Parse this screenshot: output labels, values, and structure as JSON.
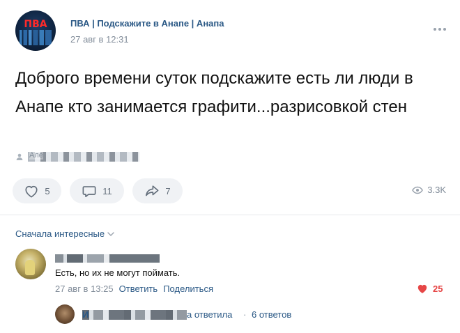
{
  "post": {
    "group_name": "ПВА | Подскажите в Анапе | Анапа",
    "avatar_logo": "ПВА",
    "time": "27 авг в 12:31",
    "text": "Доброго времени суток подскажите есть ли люди в Анапе кто занимается графити...разрисовкой стен",
    "author_prefix": "Але"
  },
  "actions": {
    "likes": "5",
    "comments": "11",
    "shares": "7",
    "views": "3.3K"
  },
  "comments": {
    "sort_label": "Сначала интересные",
    "first": {
      "text": "Есть, но их не могут поймать.",
      "time": "27 авг в 13:25",
      "reply_label": "Ответить",
      "share_label": "Поделиться",
      "likes": "25"
    },
    "reply_preview": {
      "name_prefix": "И",
      "suffix": "а ответила",
      "separator": "·",
      "replies_count": "6 ответов"
    }
  },
  "colors": {
    "link": "#2a5885",
    "muted": "#818c99",
    "like_red": "#e64646",
    "action_bg": "#f0f2f5"
  },
  "icons": [
    "more-icon",
    "author-icon",
    "heart-icon",
    "comment-icon",
    "share-icon",
    "eye-icon",
    "chevron-down-icon",
    "heart-filled-icon"
  ]
}
